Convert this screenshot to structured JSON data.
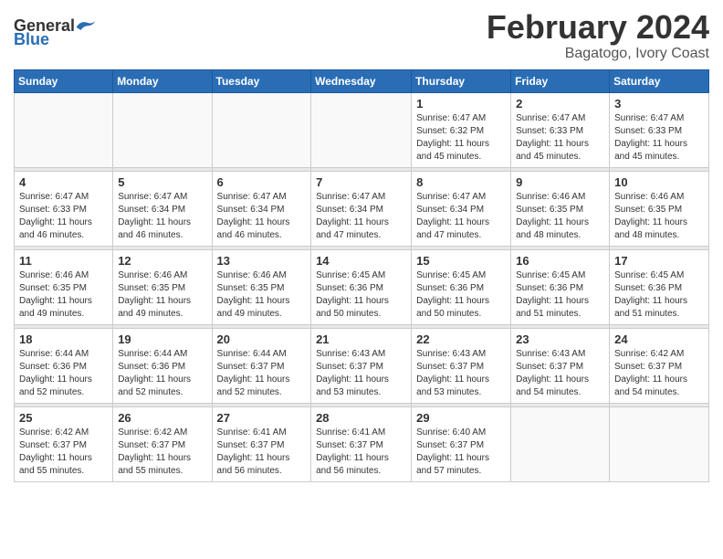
{
  "logo": {
    "general": "General",
    "blue": "Blue"
  },
  "title": "February 2024",
  "location": "Bagatogo, Ivory Coast",
  "days_of_week": [
    "Sunday",
    "Monday",
    "Tuesday",
    "Wednesday",
    "Thursday",
    "Friday",
    "Saturday"
  ],
  "weeks": [
    [
      {
        "day": "",
        "info": ""
      },
      {
        "day": "",
        "info": ""
      },
      {
        "day": "",
        "info": ""
      },
      {
        "day": "",
        "info": ""
      },
      {
        "day": "1",
        "info": "Sunrise: 6:47 AM\nSunset: 6:32 PM\nDaylight: 11 hours and 45 minutes."
      },
      {
        "day": "2",
        "info": "Sunrise: 6:47 AM\nSunset: 6:33 PM\nDaylight: 11 hours and 45 minutes."
      },
      {
        "day": "3",
        "info": "Sunrise: 6:47 AM\nSunset: 6:33 PM\nDaylight: 11 hours and 45 minutes."
      }
    ],
    [
      {
        "day": "4",
        "info": "Sunrise: 6:47 AM\nSunset: 6:33 PM\nDaylight: 11 hours and 46 minutes."
      },
      {
        "day": "5",
        "info": "Sunrise: 6:47 AM\nSunset: 6:34 PM\nDaylight: 11 hours and 46 minutes."
      },
      {
        "day": "6",
        "info": "Sunrise: 6:47 AM\nSunset: 6:34 PM\nDaylight: 11 hours and 46 minutes."
      },
      {
        "day": "7",
        "info": "Sunrise: 6:47 AM\nSunset: 6:34 PM\nDaylight: 11 hours and 47 minutes."
      },
      {
        "day": "8",
        "info": "Sunrise: 6:47 AM\nSunset: 6:34 PM\nDaylight: 11 hours and 47 minutes."
      },
      {
        "day": "9",
        "info": "Sunrise: 6:46 AM\nSunset: 6:35 PM\nDaylight: 11 hours and 48 minutes."
      },
      {
        "day": "10",
        "info": "Sunrise: 6:46 AM\nSunset: 6:35 PM\nDaylight: 11 hours and 48 minutes."
      }
    ],
    [
      {
        "day": "11",
        "info": "Sunrise: 6:46 AM\nSunset: 6:35 PM\nDaylight: 11 hours and 49 minutes."
      },
      {
        "day": "12",
        "info": "Sunrise: 6:46 AM\nSunset: 6:35 PM\nDaylight: 11 hours and 49 minutes."
      },
      {
        "day": "13",
        "info": "Sunrise: 6:46 AM\nSunset: 6:35 PM\nDaylight: 11 hours and 49 minutes."
      },
      {
        "day": "14",
        "info": "Sunrise: 6:45 AM\nSunset: 6:36 PM\nDaylight: 11 hours and 50 minutes."
      },
      {
        "day": "15",
        "info": "Sunrise: 6:45 AM\nSunset: 6:36 PM\nDaylight: 11 hours and 50 minutes."
      },
      {
        "day": "16",
        "info": "Sunrise: 6:45 AM\nSunset: 6:36 PM\nDaylight: 11 hours and 51 minutes."
      },
      {
        "day": "17",
        "info": "Sunrise: 6:45 AM\nSunset: 6:36 PM\nDaylight: 11 hours and 51 minutes."
      }
    ],
    [
      {
        "day": "18",
        "info": "Sunrise: 6:44 AM\nSunset: 6:36 PM\nDaylight: 11 hours and 52 minutes."
      },
      {
        "day": "19",
        "info": "Sunrise: 6:44 AM\nSunset: 6:36 PM\nDaylight: 11 hours and 52 minutes."
      },
      {
        "day": "20",
        "info": "Sunrise: 6:44 AM\nSunset: 6:37 PM\nDaylight: 11 hours and 52 minutes."
      },
      {
        "day": "21",
        "info": "Sunrise: 6:43 AM\nSunset: 6:37 PM\nDaylight: 11 hours and 53 minutes."
      },
      {
        "day": "22",
        "info": "Sunrise: 6:43 AM\nSunset: 6:37 PM\nDaylight: 11 hours and 53 minutes."
      },
      {
        "day": "23",
        "info": "Sunrise: 6:43 AM\nSunset: 6:37 PM\nDaylight: 11 hours and 54 minutes."
      },
      {
        "day": "24",
        "info": "Sunrise: 6:42 AM\nSunset: 6:37 PM\nDaylight: 11 hours and 54 minutes."
      }
    ],
    [
      {
        "day": "25",
        "info": "Sunrise: 6:42 AM\nSunset: 6:37 PM\nDaylight: 11 hours and 55 minutes."
      },
      {
        "day": "26",
        "info": "Sunrise: 6:42 AM\nSunset: 6:37 PM\nDaylight: 11 hours and 55 minutes."
      },
      {
        "day": "27",
        "info": "Sunrise: 6:41 AM\nSunset: 6:37 PM\nDaylight: 11 hours and 56 minutes."
      },
      {
        "day": "28",
        "info": "Sunrise: 6:41 AM\nSunset: 6:37 PM\nDaylight: 11 hours and 56 minutes."
      },
      {
        "day": "29",
        "info": "Sunrise: 6:40 AM\nSunset: 6:37 PM\nDaylight: 11 hours and 57 minutes."
      },
      {
        "day": "",
        "info": ""
      },
      {
        "day": "",
        "info": ""
      }
    ]
  ]
}
